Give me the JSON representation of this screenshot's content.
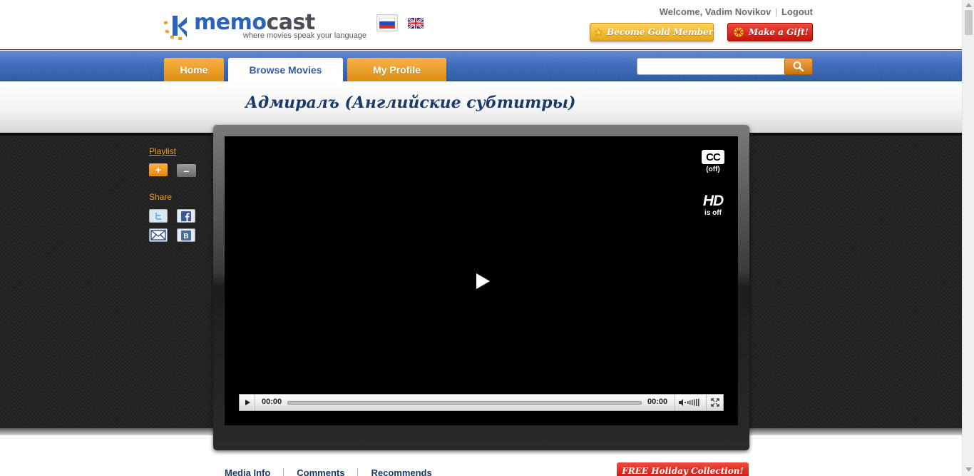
{
  "brand": {
    "name_part1": "memo",
    "name_part2": "cast",
    "tagline": "where movies speak your language",
    "accent_blue": "#2a63b8",
    "accent_orange": "#f39c22"
  },
  "languages": [
    {
      "name": "Russian",
      "icon": "russian-flag-icon"
    },
    {
      "name": "English",
      "icon": "uk-flag-icon"
    }
  ],
  "account": {
    "welcome": "Welcome, Vadim Novikov",
    "separator": "|",
    "logout": "Logout"
  },
  "promo": {
    "gold": "Become Gold Member",
    "gift": "Make a Gift!"
  },
  "nav": {
    "tabs": [
      {
        "label": "Home",
        "active": false
      },
      {
        "label": "Browse Movies",
        "active": true
      },
      {
        "label": "My Profile",
        "active": false
      }
    ],
    "search_placeholder": ""
  },
  "movie": {
    "title": "Адмиралъ (Английские субтитры)"
  },
  "sidebar": {
    "playlist_label": "Playlist",
    "add_label": "+",
    "remove_label": "–",
    "share_label": "Share",
    "share_icons": [
      "twitter-icon",
      "facebook-icon",
      "email-icon",
      "vkontakte-icon"
    ]
  },
  "player": {
    "cc_label": "CC",
    "cc_state": "(off)",
    "hd_label": "HD",
    "hd_state": "is off",
    "current_time": "00:00",
    "duration": "00:00",
    "progress": 0
  },
  "tabs_below": {
    "items": [
      "Media Info",
      "Comments",
      "Recommends"
    ],
    "holiday": "FREE Holiday Collection!"
  }
}
